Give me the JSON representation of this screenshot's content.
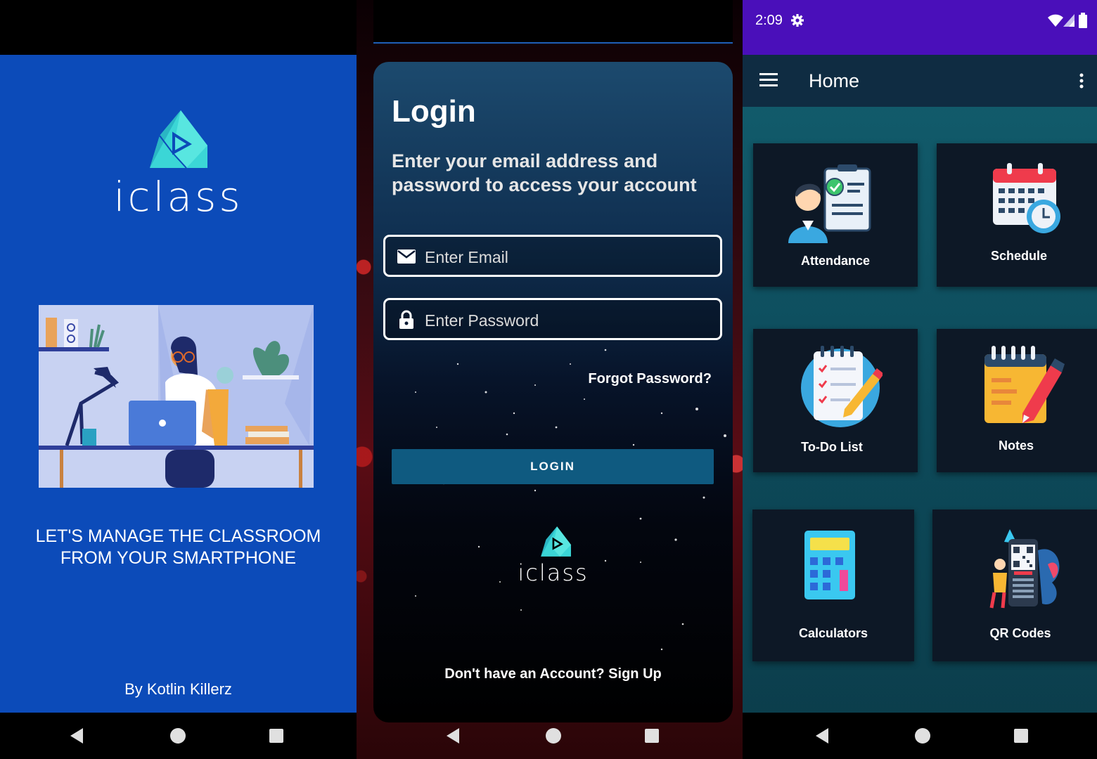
{
  "splash": {
    "brand": "iclass",
    "tagline_line1": "LET'S MANAGE THE CLASSROOM",
    "tagline_line2": "FROM YOUR SMARTPHONE",
    "byline": "By Kotlin Killerz",
    "brand_color": "#0c4bb9"
  },
  "login": {
    "title": "Login",
    "subtitle": "Enter your email address and password to access your account",
    "email_placeholder": "Enter Email",
    "password_placeholder": "Enter Password",
    "forgot": "Forgot Password?",
    "button": "LOGIN",
    "brand": "iclass",
    "signup": "Don't have an Account? Sign Up",
    "button_color": "#0f5a80"
  },
  "home": {
    "status_time": "2:09",
    "title": "Home",
    "statusbar_color": "#4a0fba",
    "appbar_color": "#0f2c42",
    "tiles": [
      {
        "label": "Attendance",
        "icon": "attendance-icon"
      },
      {
        "label": "Schedule",
        "icon": "calendar-clock-icon"
      },
      {
        "label": "To-Do List",
        "icon": "checklist-icon"
      },
      {
        "label": "Notes",
        "icon": "notepad-icon"
      },
      {
        "label": "Calculators",
        "icon": "calculator-icon"
      },
      {
        "label": "QR Codes",
        "icon": "qr-code-icon"
      }
    ]
  },
  "icons": {
    "nav_back": "back-triangle-icon",
    "nav_home": "home-circle-icon",
    "nav_recent": "recents-square-icon",
    "menu": "hamburger-icon",
    "overflow": "more-vert-icon",
    "settings": "gear-icon",
    "wifi": "wifi-icon",
    "signal": "signal-icon",
    "battery": "battery-icon",
    "email": "mail-icon",
    "lock": "lock-icon"
  }
}
